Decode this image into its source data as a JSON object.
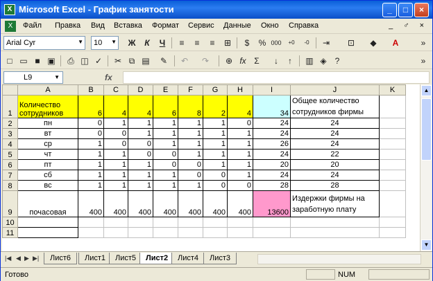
{
  "window": {
    "title": "Microsoft Excel - График занятости",
    "app_icon": "excel-icon"
  },
  "menu": [
    "Файл",
    "Правка",
    "Вид",
    "Вставка",
    "Формат",
    "Сервис",
    "Данные",
    "Окно",
    "Справка"
  ],
  "mdi_controls": "_ ♂ ×",
  "format_toolbar": {
    "font": "Arial Cyr",
    "size": "10",
    "bold": "Ж",
    "italic": "К",
    "underline": "Ч",
    "percent": "%",
    "thousands": "000",
    "more": "»"
  },
  "standard_toolbar": {
    "sigma": "Σ",
    "fx": "fx",
    "more": "»"
  },
  "formula_bar": {
    "cell": "L9",
    "fx": "fx",
    "content": ""
  },
  "columns": [
    "A",
    "B",
    "C",
    "D",
    "E",
    "F",
    "G",
    "H",
    "I",
    "J",
    "K"
  ],
  "rows": [
    {
      "n": "1",
      "a": "Количество сотрудников",
      "vals": [
        "6",
        "4",
        "4",
        "6",
        "8",
        "2",
        "4"
      ],
      "i": "34",
      "j": "Общее количество сотрудников фирмы"
    },
    {
      "n": "2",
      "a": "пн",
      "vals": [
        "0",
        "1",
        "1",
        "1",
        "1",
        "1",
        "0"
      ],
      "i": "24",
      "j": "24"
    },
    {
      "n": "3",
      "a": "вт",
      "vals": [
        "0",
        "0",
        "1",
        "1",
        "1",
        "1",
        "1"
      ],
      "i": "24",
      "j": "24"
    },
    {
      "n": "4",
      "a": "ср",
      "vals": [
        "1",
        "0",
        "0",
        "1",
        "1",
        "1",
        "1"
      ],
      "i": "26",
      "j": "24"
    },
    {
      "n": "5",
      "a": "чт",
      "vals": [
        "1",
        "1",
        "0",
        "0",
        "1",
        "1",
        "1"
      ],
      "i": "24",
      "j": "22"
    },
    {
      "n": "6",
      "a": "пт",
      "vals": [
        "1",
        "1",
        "1",
        "0",
        "0",
        "1",
        "1"
      ],
      "i": "20",
      "j": "20"
    },
    {
      "n": "7",
      "a": "сб",
      "vals": [
        "1",
        "1",
        "1",
        "1",
        "0",
        "0",
        "1"
      ],
      "i": "24",
      "j": "24"
    },
    {
      "n": "8",
      "a": "вс",
      "vals": [
        "1",
        "1",
        "1",
        "1",
        "1",
        "0",
        "0"
      ],
      "i": "28",
      "j": "28"
    },
    {
      "n": "9",
      "a": "почасовая",
      "vals": [
        "400",
        "400",
        "400",
        "400",
        "400",
        "400",
        "400"
      ],
      "i": "13600",
      "j": "Издержки фирмы на заработную плату"
    },
    {
      "n": "10",
      "a": "",
      "vals": [
        "",
        "",
        "",
        "",
        "",
        "",
        ""
      ],
      "i": "",
      "j": ""
    },
    {
      "n": "11",
      "a": "",
      "vals": [
        "",
        "",
        "",
        "",
        "",
        "",
        ""
      ],
      "i": "",
      "j": ""
    }
  ],
  "sheet_tabs": [
    "Лист6",
    "Лист1",
    "Лист5",
    "Лист2",
    "Лист4",
    "Лист3"
  ],
  "active_tab": "Лист2",
  "status": {
    "text": "Готово",
    "num": "NUM"
  },
  "colors": {
    "header_fill": "#ffff00",
    "total_fill": "#ccffff",
    "cost_fill": "#ff99cc"
  }
}
